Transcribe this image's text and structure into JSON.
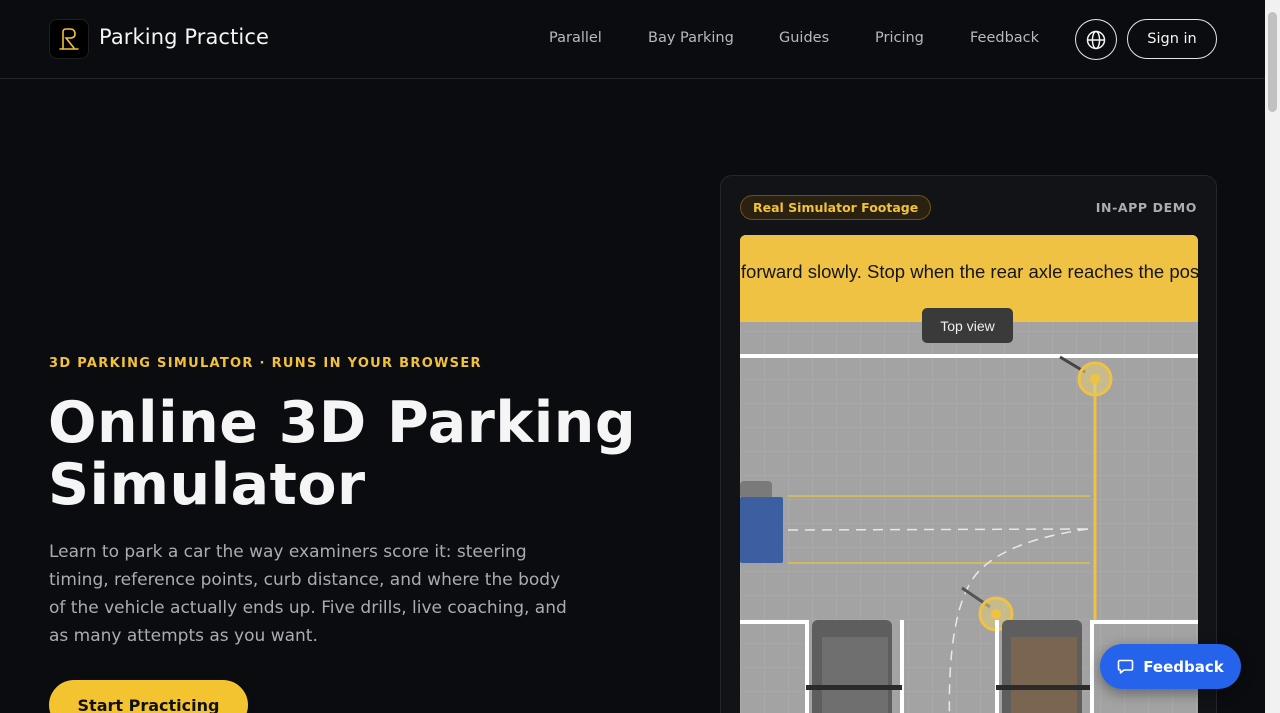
{
  "header": {
    "brand": "Parking Practice",
    "nav": [
      "Parallel",
      "Bay Parking",
      "Guides",
      "Pricing",
      "Feedback"
    ],
    "language_icon": "globe-icon",
    "signin_label": "Sign in"
  },
  "hero": {
    "eyebrow": "3D PARKING SIMULATOR · RUNS IN YOUR BROWSER",
    "headline": "Online 3D Parking Simulator",
    "lede": "Learn to park a car the way examiners score it: steering timing, reference points, curb distance, and where the body of the vehicle actually ends up. Five drills, live coaching, and as many attempts as you want.",
    "cta_label": "Start Practicing"
  },
  "demo": {
    "badge": "Real Simulator Footage",
    "tag": "IN-APP DEMO",
    "instruction": "Drive forward slowly. Stop when the rear axle reaches the post line.",
    "view_tooltip": "Top view"
  },
  "feedback_fab": {
    "label": "Feedback",
    "icon": "chat-bubble-icon"
  },
  "colors": {
    "background": "#0b0c0f",
    "accent_yellow": "#f4c430",
    "fab_blue": "#2563eb"
  }
}
